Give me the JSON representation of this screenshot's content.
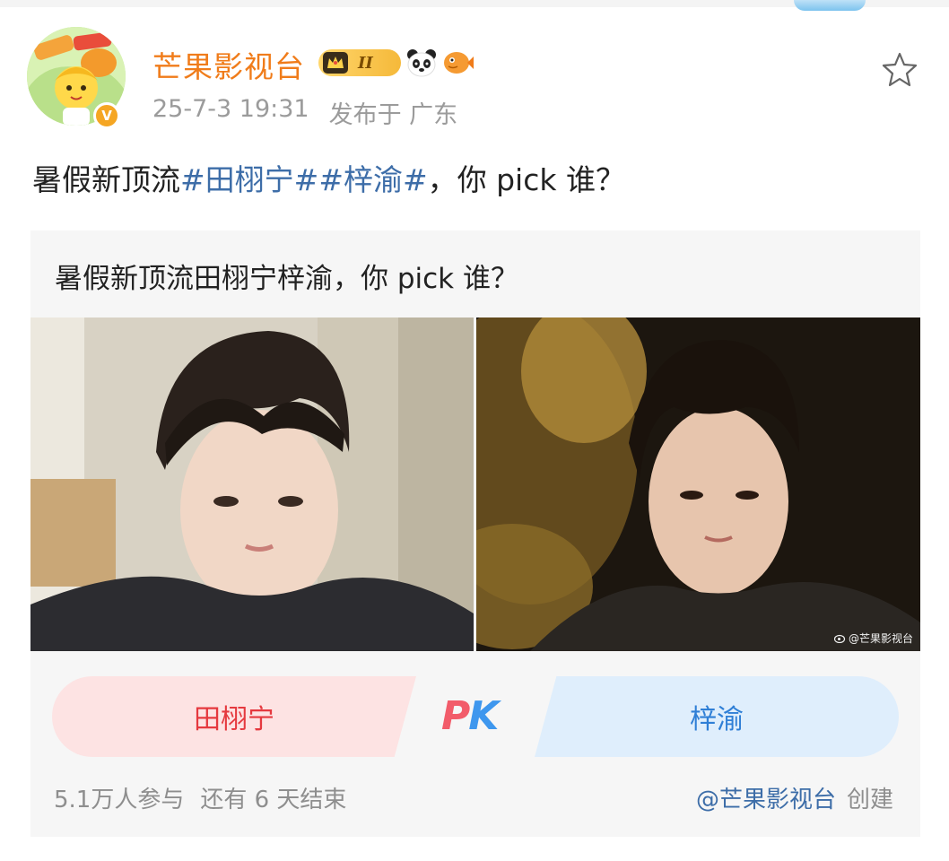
{
  "header": {
    "username": "芒果影视台",
    "vip_level": "II",
    "timestamp": "25-7-3 19:31",
    "location": "发布于 广东"
  },
  "post": {
    "text_prefix": "暑假新顶流",
    "tag_1": "#田栩宁#",
    "tag_2": "#梓渝#",
    "text_suffix": "，你 pick 谁？"
  },
  "poll": {
    "title": "暑假新顶流田栩宁梓渝，你 pick 谁？",
    "watermark": "@芒果影视台",
    "option_left": "田栩宁",
    "option_right": "梓渝",
    "pk_p": "P",
    "pk_k": "K",
    "participants": "5.1万人参与",
    "remaining": "还有 6 天结束",
    "creator_handle": "@芒果影视台",
    "creator_suffix": "创建"
  },
  "icons": {
    "avatar": "mango-mascot-avatar",
    "verified": "verified-badge-icon",
    "vip": "vip-crown-badge-icon",
    "panda": "panda-badge-icon",
    "fish": "fish-badge-icon",
    "favorite": "star-outline-icon"
  },
  "colors": {
    "username": "#f07c1a",
    "hashtag": "#3d6da8",
    "vote_left": "#e5393f",
    "vote_right": "#2f7fd6",
    "vote_left_bg": "#fde3e3",
    "vote_right_bg": "#dfeefc"
  }
}
